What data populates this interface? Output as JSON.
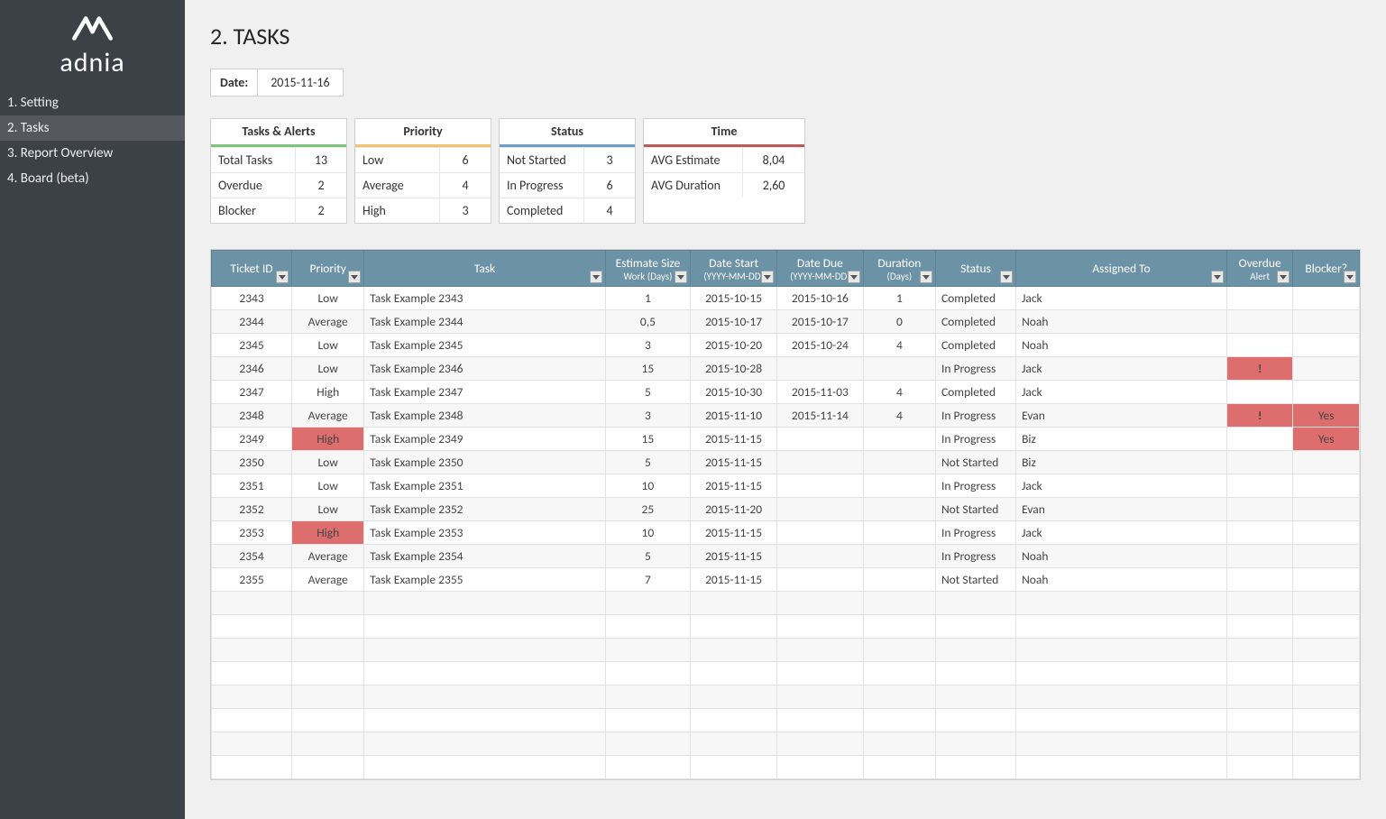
{
  "brand_name": "adnia",
  "sidebar": {
    "items": [
      {
        "label": "1. Setting"
      },
      {
        "label": "2. Tasks"
      },
      {
        "label": "3. Report Overview"
      },
      {
        "label": "4. Board (beta)"
      }
    ],
    "active_index": 1
  },
  "page": {
    "title": "2. TASKS",
    "date_label": "Date:",
    "date_value": "2015-11-16"
  },
  "summary": {
    "tasks_alerts": {
      "title": "Tasks & Alerts",
      "rows": [
        {
          "label": "Total Tasks",
          "value": "13"
        },
        {
          "label": "Overdue",
          "value": "2"
        },
        {
          "label": "Blocker",
          "value": "2"
        }
      ]
    },
    "priority": {
      "title": "Priority",
      "rows": [
        {
          "label": "Low",
          "value": "6"
        },
        {
          "label": "Average",
          "value": "4"
        },
        {
          "label": "High",
          "value": "3"
        }
      ]
    },
    "status": {
      "title": "Status",
      "rows": [
        {
          "label": "Not Started",
          "value": "3"
        },
        {
          "label": "In Progress",
          "value": "6"
        },
        {
          "label": "Completed",
          "value": "4"
        }
      ]
    },
    "time": {
      "title": "Time",
      "rows": [
        {
          "label": "AVG Estimate",
          "value": "8,04"
        },
        {
          "label": "AVG Duration",
          "value": "2,60"
        }
      ]
    }
  },
  "columns": [
    {
      "label": "Ticket ID",
      "sub": ""
    },
    {
      "label": "Priority",
      "sub": ""
    },
    {
      "label": "Task",
      "sub": ""
    },
    {
      "label": "Estimate Size",
      "sub": "Work (Days)"
    },
    {
      "label": "Date Start",
      "sub": "(YYYY-MM-DD)"
    },
    {
      "label": "Date Due",
      "sub": "(YYYY-MM-DD)"
    },
    {
      "label": "Duration",
      "sub": "(Days)"
    },
    {
      "label": "Status",
      "sub": ""
    },
    {
      "label": "Assigned To",
      "sub": ""
    },
    {
      "label": "Overdue",
      "sub": "Alert"
    },
    {
      "label": "Blocker?",
      "sub": ""
    }
  ],
  "rows": [
    {
      "ticket": "2343",
      "priority": "Low",
      "task": "Task Example 2343",
      "estimate": "1",
      "start": "2015-10-15",
      "due": "2015-10-16",
      "duration": "1",
      "status": "Completed",
      "assigned": "Jack",
      "overdue": "",
      "blocker": ""
    },
    {
      "ticket": "2344",
      "priority": "Average",
      "task": "Task Example 2344",
      "estimate": "0,5",
      "start": "2015-10-17",
      "due": "2015-10-17",
      "duration": "0",
      "status": "Completed",
      "assigned": "Noah",
      "overdue": "",
      "blocker": ""
    },
    {
      "ticket": "2345",
      "priority": "Low",
      "task": "Task Example 2345",
      "estimate": "3",
      "start": "2015-10-20",
      "due": "2015-10-24",
      "duration": "4",
      "status": "Completed",
      "assigned": "Noah",
      "overdue": "",
      "blocker": ""
    },
    {
      "ticket": "2346",
      "priority": "Low",
      "task": "Task Example 2346",
      "estimate": "15",
      "start": "2015-10-28",
      "due": "",
      "duration": "",
      "status": "In Progress",
      "assigned": "Jack",
      "overdue": "!",
      "blocker": ""
    },
    {
      "ticket": "2347",
      "priority": "High",
      "task": "Task Example 2347",
      "estimate": "5",
      "start": "2015-10-30",
      "due": "2015-11-03",
      "duration": "4",
      "status": "Completed",
      "assigned": "Jack",
      "overdue": "",
      "blocker": ""
    },
    {
      "ticket": "2348",
      "priority": "Average",
      "task": "Task Example 2348",
      "estimate": "3",
      "start": "2015-11-10",
      "due": "2015-11-14",
      "duration": "4",
      "status": "In Progress",
      "assigned": "Evan",
      "overdue": "!",
      "blocker": "Yes"
    },
    {
      "ticket": "2349",
      "priority": "High",
      "priority_highlight": true,
      "task": "Task Example 2349",
      "estimate": "15",
      "start": "2015-11-15",
      "due": "",
      "duration": "",
      "status": "In Progress",
      "assigned": "Biz",
      "overdue": "",
      "blocker": "Yes"
    },
    {
      "ticket": "2350",
      "priority": "Low",
      "task": "Task Example 2350",
      "estimate": "5",
      "start": "2015-11-15",
      "due": "",
      "duration": "",
      "status": "Not Started",
      "assigned": "Biz",
      "overdue": "",
      "blocker": ""
    },
    {
      "ticket": "2351",
      "priority": "Low",
      "task": "Task Example 2351",
      "estimate": "10",
      "start": "2015-11-15",
      "due": "",
      "duration": "",
      "status": "In Progress",
      "assigned": "Jack",
      "overdue": "",
      "blocker": ""
    },
    {
      "ticket": "2352",
      "priority": "Low",
      "task": "Task Example 2352",
      "estimate": "25",
      "start": "2015-11-20",
      "due": "",
      "duration": "",
      "status": "Not Started",
      "assigned": "Evan",
      "overdue": "",
      "blocker": ""
    },
    {
      "ticket": "2353",
      "priority": "High",
      "priority_highlight": true,
      "task": "Task Example 2353",
      "estimate": "10",
      "start": "2015-11-15",
      "due": "",
      "duration": "",
      "status": "In Progress",
      "assigned": "Jack",
      "overdue": "",
      "blocker": ""
    },
    {
      "ticket": "2354",
      "priority": "Average",
      "task": "Task Example 2354",
      "estimate": "5",
      "start": "2015-11-15",
      "due": "",
      "duration": "",
      "status": "In Progress",
      "assigned": "Noah",
      "overdue": "",
      "blocker": ""
    },
    {
      "ticket": "2355",
      "priority": "Average",
      "task": "Task Example 2355",
      "estimate": "7",
      "start": "2015-11-15",
      "due": "",
      "duration": "",
      "status": "Not Started",
      "assigned": "Noah",
      "overdue": "",
      "blocker": ""
    }
  ],
  "empty_rows": 8
}
